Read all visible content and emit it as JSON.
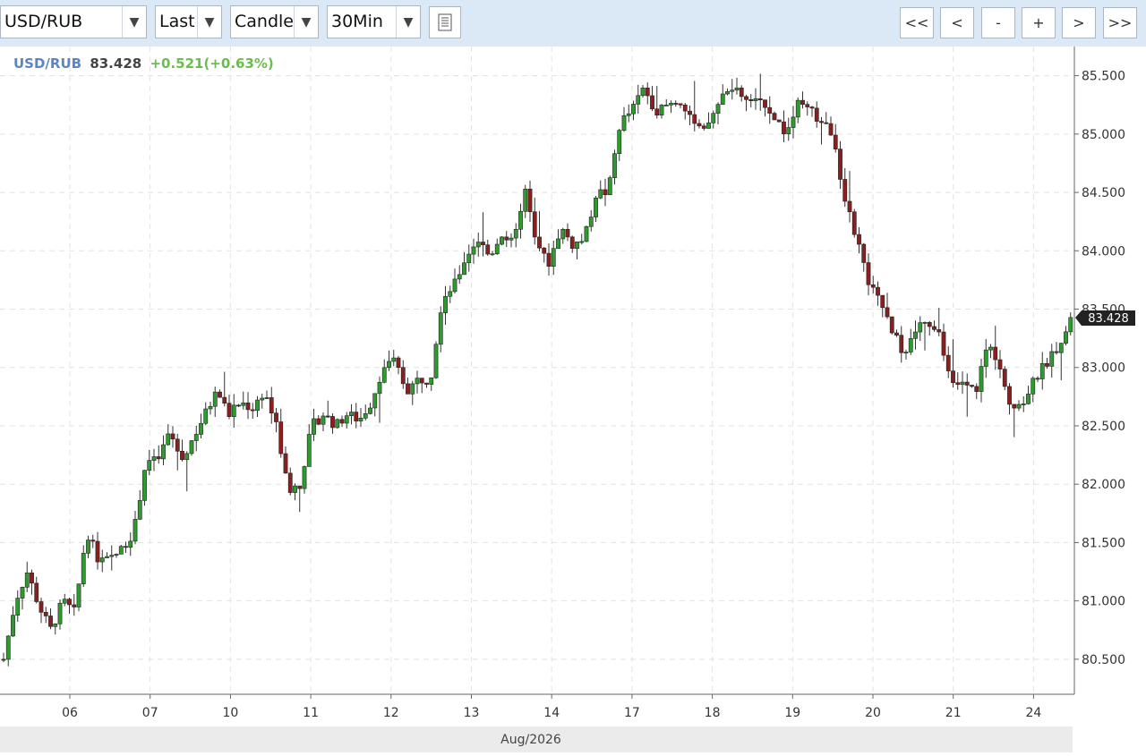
{
  "toolbar": {
    "symbol": "USD/RUB",
    "price_type": "Last",
    "chart_style": "Candle",
    "interval": "30Min",
    "dropdown_arrow": "▼",
    "nav_buttons": [
      "<<",
      "<",
      "-",
      "+",
      ">",
      ">>"
    ]
  },
  "legend": {
    "symbol": "USD/RUB",
    "price": "83.428",
    "change": "+0.521(+0.63%)"
  },
  "colors": {
    "up": "#2e9b2e",
    "down": "#8b1e1e",
    "grid": "#e3e3e3",
    "toolbar_bg": "#dbe8f5",
    "axis_bg": "#ebebeb"
  },
  "chart_data": {
    "type": "candlestick",
    "symbol": "USD/RUB",
    "interval": "30Min",
    "x_axis_title": "Aug/2026",
    "x_tick_labels": [
      "06",
      "07",
      "10",
      "11",
      "12",
      "13",
      "14",
      "17",
      "18",
      "19",
      "20",
      "21",
      "24"
    ],
    "y_tick_labels": [
      "85.500",
      "85.000",
      "84.500",
      "84.000",
      "83.500",
      "83.000",
      "82.500",
      "82.000",
      "81.500",
      "81.000",
      "80.500"
    ],
    "ylim": [
      80.2,
      85.75
    ],
    "last_price": 83.428,
    "last_price_label": "83.428",
    "change": 0.521,
    "change_percent": 0.63,
    "grid": true,
    "close_path": [
      [
        0,
        80.5
      ],
      [
        1,
        81.0
      ],
      [
        2,
        81.25
      ],
      [
        3,
        80.95
      ],
      [
        4,
        80.75
      ],
      [
        5,
        81.0
      ],
      [
        6,
        80.9
      ],
      [
        7,
        81.6
      ],
      [
        8,
        81.35
      ],
      [
        9,
        81.35
      ],
      [
        10,
        81.45
      ],
      [
        11,
        81.6
      ],
      [
        12,
        82.2
      ],
      [
        13,
        82.2
      ],
      [
        14,
        82.45
      ],
      [
        15,
        82.2
      ],
      [
        16,
        82.4
      ],
      [
        17,
        82.6
      ],
      [
        18,
        82.8
      ],
      [
        19,
        82.6
      ],
      [
        20,
        82.7
      ],
      [
        21,
        82.65
      ],
      [
        22,
        82.8
      ],
      [
        23,
        82.5
      ],
      [
        24,
        81.95
      ],
      [
        25,
        82.0
      ],
      [
        26,
        82.5
      ],
      [
        27,
        82.6
      ],
      [
        28,
        82.5
      ],
      [
        29,
        82.6
      ],
      [
        30,
        82.55
      ],
      [
        31,
        82.7
      ],
      [
        32,
        83.0
      ],
      [
        33,
        83.05
      ],
      [
        34,
        82.8
      ],
      [
        35,
        82.9
      ],
      [
        36,
        82.9
      ],
      [
        37,
        83.6
      ],
      [
        38,
        83.7
      ],
      [
        39,
        83.95
      ],
      [
        40,
        84.1
      ],
      [
        41,
        83.95
      ],
      [
        42,
        84.15
      ],
      [
        43,
        84.05
      ],
      [
        44,
        84.5
      ],
      [
        45,
        84.0
      ],
      [
        46,
        83.9
      ],
      [
        47,
        84.2
      ],
      [
        48,
        84.05
      ],
      [
        49,
        84.1
      ],
      [
        50,
        84.5
      ],
      [
        51,
        84.5
      ],
      [
        52,
        85.1
      ],
      [
        53,
        85.2
      ],
      [
        54,
        85.4
      ],
      [
        55,
        85.2
      ],
      [
        56,
        85.25
      ],
      [
        57,
        85.3
      ],
      [
        58,
        85.1
      ],
      [
        59,
        85.0
      ],
      [
        60,
        85.2
      ],
      [
        61,
        85.4
      ],
      [
        62,
        85.35
      ],
      [
        63,
        85.25
      ],
      [
        64,
        85.3
      ],
      [
        65,
        85.15
      ],
      [
        66,
        85.0
      ],
      [
        67,
        85.25
      ],
      [
        68,
        85.2
      ],
      [
        69,
        85.1
      ],
      [
        70,
        85.0
      ],
      [
        71,
        84.4
      ],
      [
        72,
        84.1
      ],
      [
        73,
        83.7
      ],
      [
        74,
        83.55
      ],
      [
        75,
        83.3
      ],
      [
        76,
        83.1
      ],
      [
        77,
        83.35
      ],
      [
        78,
        83.4
      ],
      [
        79,
        83.25
      ],
      [
        80,
        82.85
      ],
      [
        81,
        82.85
      ],
      [
        82,
        82.8
      ],
      [
        83,
        83.2
      ],
      [
        84,
        83.05
      ],
      [
        85,
        82.65
      ],
      [
        86,
        82.7
      ],
      [
        87,
        82.9
      ],
      [
        88,
        83.05
      ],
      [
        89,
        83.2
      ],
      [
        90,
        83.428
      ]
    ]
  }
}
